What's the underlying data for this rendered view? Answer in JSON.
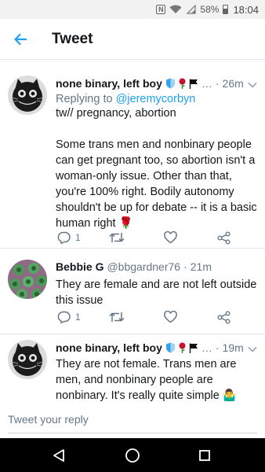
{
  "status_bar": {
    "battery": "58%",
    "time": "18:04"
  },
  "header": {
    "title": "Tweet"
  },
  "tweets": [
    {
      "name": "none binary, left boy",
      "time": "26m",
      "replying_prefix": "Replying to",
      "replying_to": "@jeremycorbyn",
      "text": "tw// pregnancy, abortion\n\nSome trans men and nonbinary people can get pregnant too, so abortion isn't a woman-only issue. Other than that, you're 100% right. Bodily autonomy shouldn't be up for debate -- it is a basic human right 🌹",
      "reply_count": "1"
    },
    {
      "name": "Bebbie G",
      "handle": "@bbgardner76",
      "time": "21m",
      "text": "They are female and are not left outside this issue",
      "reply_count": "1"
    },
    {
      "name": "none binary, left boy",
      "time": "19m",
      "text": "They are not female. Trans men are men, and nonbinary people are nonbinary. It's really quite simple 🤷‍♂️"
    }
  ],
  "reply": {
    "placeholder": "Tweet your reply"
  },
  "colors": {
    "accent": "#1da1f2",
    "secondary_text": "#657786",
    "divider": "#e1e8ed"
  },
  "icons": {
    "back": "back-arrow-icon",
    "reply": "reply-icon",
    "retweet": "retweet-icon",
    "like": "heart-icon",
    "share": "share-icon",
    "caret": "chevron-down-icon",
    "nav_back": "nav-back-icon",
    "nav_home": "nav-home-icon",
    "nav_recents": "nav-recents-icon"
  }
}
